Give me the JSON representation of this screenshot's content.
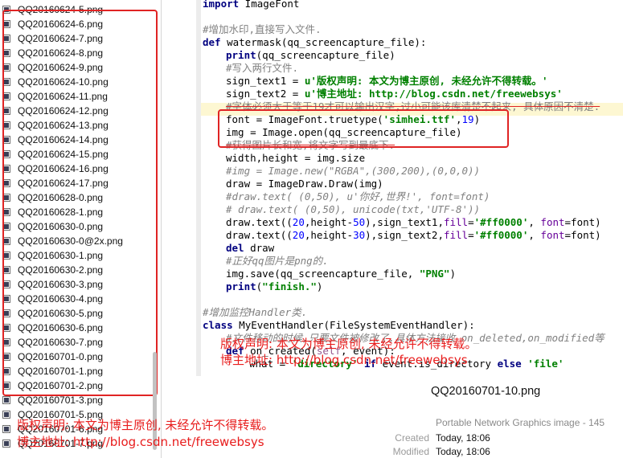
{
  "file_list": {
    "items": [
      "QQ20160624-5.png",
      "QQ20160624-6.png",
      "QQ20160624-7.png",
      "QQ20160624-8.png",
      "QQ20160624-9.png",
      "QQ20160624-10.png",
      "QQ20160624-11.png",
      "QQ20160624-12.png",
      "QQ20160624-13.png",
      "QQ20160624-14.png",
      "QQ20160624-15.png",
      "QQ20160624-16.png",
      "QQ20160624-17.png",
      "QQ20160628-0.png",
      "QQ20160628-1.png",
      "QQ20160630-0.png",
      "QQ20160630-0@2x.png",
      "QQ20160630-1.png",
      "QQ20160630-2.png",
      "QQ20160630-3.png",
      "QQ20160630-4.png",
      "QQ20160630-5.png",
      "QQ20160630-6.png",
      "QQ20160630-7.png",
      "QQ20160701-0.png",
      "QQ20160701-1.png",
      "QQ20160701-2.png",
      "QQ20160701-3.png",
      "QQ20160701-5.png",
      "QQ20160701-6.png",
      "QQ20160701-7.png"
    ]
  },
  "code": {
    "l01_kw": "import",
    "l01_rest": " ImageFont",
    "l03": "#增加水印,直接写入文件.",
    "l04_kw": "def",
    "l04_name": " watermask",
    "l04_args": "(qq_screencapture_file):",
    "l05_kw": "print",
    "l05_rest": "(qq_screencapture_file)",
    "l06": "#写入两行文件.",
    "l07_pre": "sign_text1 = ",
    "l07_str": "u'版权声明: 本文为博主原创, 未经允许不得转载。'",
    "l08_pre": "sign_text2 = ",
    "l08_str": "u'博主地址: http://blog.csdn.net/freewebsys'",
    "l09": "#字体必须大于等于19才可以输出汉字,过小可能该库清楚不起来, 具体原因不清楚.",
    "l10_pre": "font = ImageFont.truetype(",
    "l10_str": "'simhei.ttf'",
    "l10_mid": ",",
    "l10_num": "19",
    "l10_end": ")",
    "l11": "img = Image.open(qq_screencapture_file)",
    "l12": "#获得图片长和宽,将文字写到最底下.",
    "l13": "width,height = img.size",
    "l14": "#img = Image.new(\"RGBA\",(300,200),(0,0,0))",
    "l15": "draw = ImageDraw.Draw(img)",
    "l16": "#draw.text( (0,50), u'你好,世界!', font=font)",
    "l17": "# draw.text( (0,50), unicode(txt,'UTF-8'))",
    "l18_a": "draw.text((",
    "l18_n1": "20",
    "l18_b": ",height-",
    "l18_n2": "50",
    "l18_c": "),sign_text1,",
    "l18_p1": "fill",
    "l18_eq": "=",
    "l18_s": "'#ff0000'",
    "l18_d": ", ",
    "l18_p2": "font",
    "l18_e": "=font)",
    "l19_a": "draw.text((",
    "l19_n1": "20",
    "l19_b": ",height-",
    "l19_n2": "30",
    "l19_c": "),sign_text2,",
    "l19_p1": "fill",
    "l19_eq": "=",
    "l19_s": "'#ff0000'",
    "l19_d": ", ",
    "l19_p2": "font",
    "l19_e": "=font)",
    "l20_kw": "del",
    "l20_rest": " draw",
    "l21": "#正好qq图片是png的.",
    "l22_pre": "img.save(qq_screencapture_file, ",
    "l22_str": "\"PNG\"",
    "l22_end": ")",
    "l23_kw": "print",
    "l23_pre": "(",
    "l23_str": "\"finish.\"",
    "l23_end": ")",
    "l25": "#增加监控Handler类.",
    "l26_kw": "class",
    "l26_rest": " MyEventHandler(FileSystemEventHandler):",
    "l27": "#文件移动的时候,只要文件被修改了,具体方法接收 on_deleted,on_modified等",
    "l28_kw": "def",
    "l28_name": " on_created",
    "l28_a": "(",
    "l28_self": "self",
    "l28_b": ", event):",
    "l29_a": "what = ",
    "l29_s1": "'directory'",
    "l29_kw1": " if",
    "l29_b": " event.is_directory ",
    "l29_kw2": "else",
    "l29_s2": " 'file'"
  },
  "watermark_code": {
    "line1": "版权声明: 本文为博主原创, 未经允许不得转载。",
    "line2": "博主地址: http://blog.csdn.net/freewebsys"
  },
  "watermark_bottom": {
    "line1": "版权声明: 本文为博主原创, 未经允许不得转载。",
    "line2": "博主地址: http://blog.csdn.net/freewebsys"
  },
  "preview": {
    "file_name": "QQ20160701-10.png",
    "kind": "Portable Network Graphics image - 145",
    "created_label": "Created",
    "created_value": "Today, 18:06",
    "modified_label": "Modified",
    "modified_value": "Today, 18:06"
  },
  "colors": {
    "highlight_box": "#e02424",
    "watermark": "#e81d1d",
    "keyword": "#000080",
    "string": "#008000",
    "comment": "#808080"
  }
}
